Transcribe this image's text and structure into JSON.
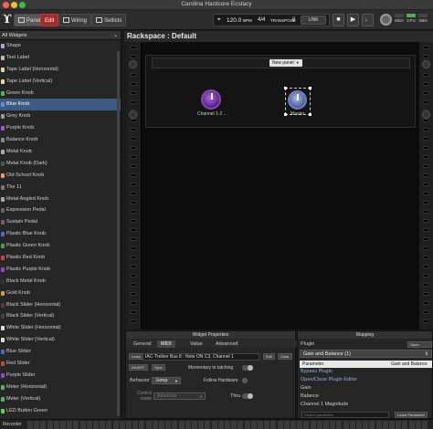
{
  "window": {
    "title": "Carolina Hardcore Ecstacy"
  },
  "toolbar": {
    "panels_label": "Panels",
    "edit_label": "Edit",
    "wiring_label": "Wiring",
    "setlists_label": "Setlists",
    "tempo": "120.0",
    "bpm_label": "BPM",
    "time_signature": "4/4",
    "transpose_label": "TRANSPOSE",
    "transpose_value": "0",
    "link_label": "LINK",
    "status": {
      "midi": "MIDI",
      "cpu": "CPU",
      "ssn": "SBN"
    }
  },
  "sidebar": {
    "filter_label": "All Widgets",
    "selected_index": 5,
    "items": [
      {
        "label": "Shape",
        "color": "#9fb4c8"
      },
      {
        "label": "Text Label",
        "color": "#bbbbbb"
      },
      {
        "label": "Tape Label (Horizontal)",
        "color": "#e8d9a0"
      },
      {
        "label": "Tape Label (Vertical)",
        "color": "#e8d9a0"
      },
      {
        "label": "Green Knob",
        "color": "#5bb25b"
      },
      {
        "label": "Blue Knob",
        "color": "#6d8ad6"
      },
      {
        "label": "Grey Knob",
        "color": "#999999"
      },
      {
        "label": "Purple Knob",
        "color": "#9a5ad0"
      },
      {
        "label": "Balance Knob",
        "color": "#888888"
      },
      {
        "label": "Metal Knob",
        "color": "#aaaaaa"
      },
      {
        "label": "Metal Knob (Dark)",
        "color": "#555555"
      },
      {
        "label": "Old School Knob",
        "color": "#c9a86a"
      },
      {
        "label": "The 11",
        "color": "#777777"
      },
      {
        "label": "Metal Angled Knob",
        "color": "#aaaaaa"
      },
      {
        "label": "Expression Pedal",
        "color": "#666666"
      },
      {
        "label": "Sustain Pedal",
        "color": "#666666"
      },
      {
        "label": "Plastic Blue Knob",
        "color": "#4a6fc0"
      },
      {
        "label": "Plastic Green Knob",
        "color": "#4aa04a"
      },
      {
        "label": "Plastic Red Knob",
        "color": "#c04a4a"
      },
      {
        "label": "Plastic Purple Knob",
        "color": "#8a4ac0"
      },
      {
        "label": "Black Metal Knob",
        "color": "#333333"
      },
      {
        "label": "Gold Knob",
        "color": "#c9a24a"
      },
      {
        "label": "Black Slider (Horizontal)",
        "color": "#444444"
      },
      {
        "label": "Black Slider (Vertical)",
        "color": "#444444"
      },
      {
        "label": "White Slider (Horizontal)",
        "color": "#dddddd"
      },
      {
        "label": "White Slider (Vertical)",
        "color": "#dddddd"
      },
      {
        "label": "Blue Slider",
        "color": "#4a6fc0"
      },
      {
        "label": "Red Slider",
        "color": "#c04a4a"
      },
      {
        "label": "Purple Slider",
        "color": "#8a4ac0"
      },
      {
        "label": "Meter (Horizontal)",
        "color": "#5bb25b"
      },
      {
        "label": "Meter (Vertical)",
        "color": "#5bb25b"
      },
      {
        "label": "LED Button Green",
        "color": "#5bd05b"
      }
    ]
  },
  "rackspace": {
    "title": "Rackspace : Default",
    "new_panel_label": "New panel",
    "widgets": [
      {
        "label": "Channel 1-2 ..."
      },
      {
        "label": "Master"
      }
    ]
  },
  "widget_properties": {
    "title": "Widget Properties",
    "tabs": [
      "General",
      "MIDI",
      "Value",
      "Advanced"
    ],
    "active_tab": "MIDI",
    "learn_label": "Learn",
    "midi_binding": "IAC-Treiber Bus 8 : Note ON C3, Channel 1",
    "edit_label": "Edit",
    "clear_label": "Clear",
    "invert_label": "INVERT",
    "sync_label": "Sync",
    "momentary_label": "Momentary to latching",
    "behavior_label": "Behavior",
    "behavior_value": "Jump",
    "follow_hardware_label": "Follow Hardware",
    "control_mode_label": "Control mode",
    "control_mode_value": "Absolute",
    "thru_label": "Thru"
  },
  "mapping": {
    "title": "Mapping",
    "plugin_label": "Plugin",
    "open_plugin_label": "Open plugin",
    "selected_plugin": "Gain and Balance (1)",
    "param_header": "Parameter",
    "param_header_value": "Gain and Balance",
    "rows": [
      "Bypass Plugin",
      "Open/Close Plugin Editor",
      "Gain",
      "Balance",
      "Channel 1 Magnitude"
    ],
    "search_placeholder": "Search parameter",
    "learn_parameter_label": "Learn Parameter"
  },
  "statusbar": {
    "recorder_label": "Recorder"
  }
}
